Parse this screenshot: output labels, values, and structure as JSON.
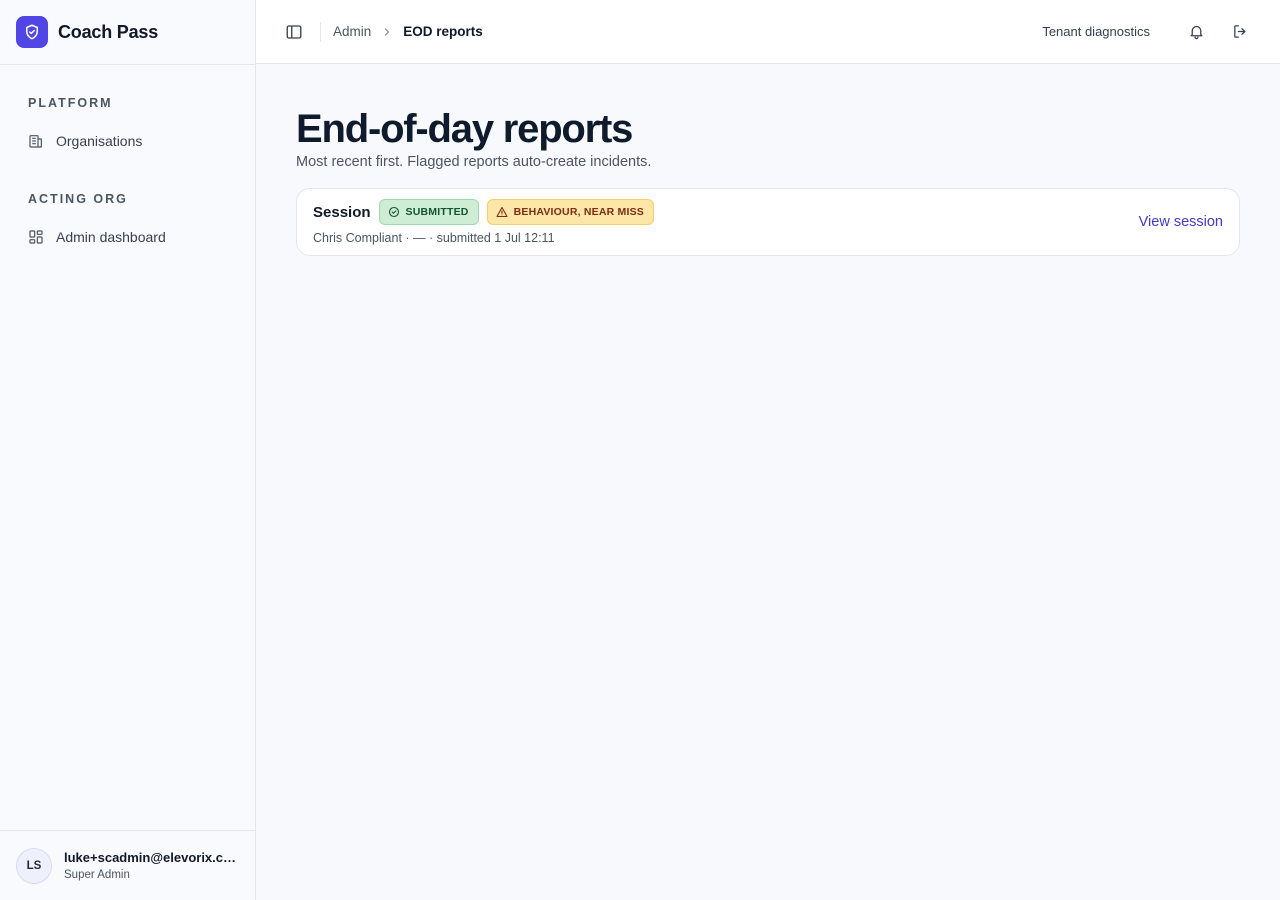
{
  "app": {
    "name": "Coach Pass"
  },
  "sidebar": {
    "sections": [
      {
        "heading": "PLATFORM",
        "items": [
          {
            "label": "Organisations",
            "icon": "building-icon"
          }
        ]
      },
      {
        "heading": "ACTING ORG",
        "items": [
          {
            "label": "Admin dashboard",
            "icon": "dashboard-grid-icon"
          }
        ]
      }
    ],
    "user": {
      "initials": "LS",
      "email": "luke+scadmin@elevorix.co.uk",
      "role": "Super Admin"
    }
  },
  "topbar": {
    "breadcrumb": [
      {
        "label": "Admin"
      },
      {
        "label": "EOD reports"
      }
    ],
    "diagnostics_label": "Tenant diagnostics"
  },
  "page": {
    "title": "End-of-day reports",
    "subtitle": "Most recent first. Flagged reports auto-create incidents."
  },
  "reports": [
    {
      "title": "Session",
      "status_badge": "SUBMITTED",
      "flag_badge": "BEHAVIOUR, NEAR MISS",
      "meta": "Chris Compliant · — · submitted 1 Jul 12:11",
      "action_label": "View session"
    }
  ],
  "colors": {
    "brand": "#4f46e5",
    "link": "#4338ca",
    "submitted_bg": "#cdeed5",
    "flag_bg": "#fde7a8"
  }
}
